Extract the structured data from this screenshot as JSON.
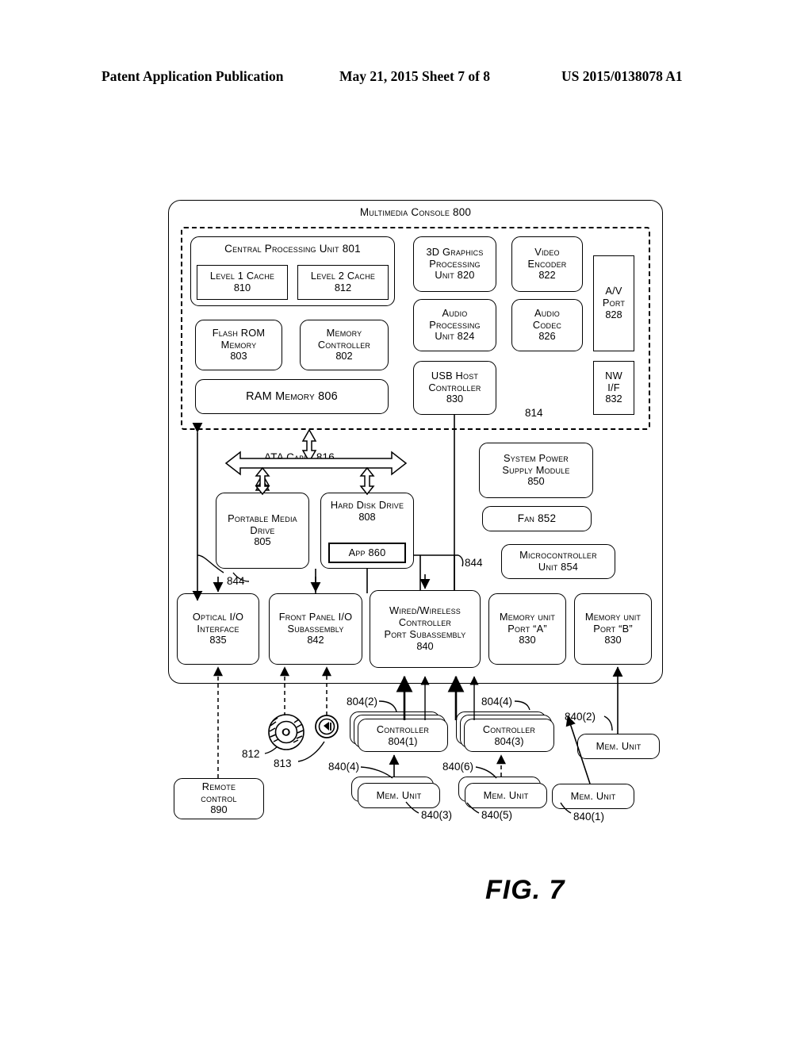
{
  "header": {
    "publication": "Patent Application Publication",
    "date_sheet": "May 21, 2015  Sheet 7 of 8",
    "patent_number": "US 2015/0138078 A1"
  },
  "figure": {
    "label": "FIG. 7"
  },
  "diagram": {
    "console_title": "Multimedia Console 800",
    "cpu": {
      "title": "Central Processing Unit 801",
      "cache1": {
        "line1": "Level 1 Cache",
        "line2": "810"
      },
      "cache2": {
        "line1": "Level 2 Cache",
        "line2": "812"
      }
    },
    "flash_rom": {
      "line1": "Flash ROM",
      "line2": "Memory",
      "line3": "803"
    },
    "memory_controller": {
      "line1": "Memory",
      "line2": "Controller",
      "line3": "802"
    },
    "ram": {
      "line1": "RAM Memory 806"
    },
    "gpu": {
      "line1": "3D Graphics",
      "line2": "Processing",
      "line3": "Unit 820"
    },
    "video_encoder": {
      "line1": "Video",
      "line2": "Encoder",
      "line3": "822"
    },
    "audio_processing": {
      "line1": "Audio",
      "line2": "Processing",
      "line3": "Unit 824"
    },
    "audio_codec": {
      "line1": "Audio",
      "line2": "Codec",
      "line3": "826"
    },
    "usb_host": {
      "line1": "USB Host",
      "line2": "Controller",
      "line3": "830"
    },
    "av_port": {
      "line1": "A/V",
      "line2": "Port",
      "line3": "828"
    },
    "nw_if": {
      "line1": "NW",
      "line2": "I/F",
      "line3": "832"
    },
    "bus_label_814": "814",
    "ata_cable": "ATA Cable 816",
    "portable_media_drive": {
      "line1": "Portable Media",
      "line2": "Drive",
      "line3": "805"
    },
    "hard_disk_drive": {
      "line1": "Hard Disk Drive",
      "line2": "808"
    },
    "app": {
      "line1": "App 860"
    },
    "power_supply": {
      "line1": "System Power",
      "line2": "Supply Module",
      "line3": "850"
    },
    "fan": {
      "line1": "Fan 852"
    },
    "microcontroller": {
      "line1": "Microcontroller",
      "line2": "Unit 854"
    },
    "optical_io": {
      "line1": "Optical I/O",
      "line2": "Interface",
      "line3": "835"
    },
    "front_panel_io": {
      "line1": "Front Panel I/O",
      "line2": "Subassembly",
      "line3": "842"
    },
    "wired_wireless": {
      "line1": "Wired/Wireless",
      "line2": "Controller",
      "line3": "Port Subassembly",
      "line4": "840"
    },
    "memory_unit_port_a": {
      "line1": "Memory unit",
      "line2": "Port “A”",
      "line3": "830"
    },
    "memory_unit_port_b": {
      "line1": "Memory unit",
      "line2": "Port “B”",
      "line3": "830"
    },
    "callout_844_left": "844",
    "callout_844_right": "844",
    "callout_812": "812",
    "callout_813": "813",
    "remote_control": {
      "line1": "Remote",
      "line2": "control",
      "line3": "890"
    },
    "controller_1": {
      "line1": "Controller",
      "line2": "804(1)"
    },
    "controller_3": {
      "line1": "Controller",
      "line2": "804(3)"
    },
    "callout_804_2": "804(2)",
    "callout_804_4": "804(4)",
    "mem_unit_label": "Mem. Unit",
    "callout_840_1": "840(1)",
    "callout_840_2": "840(2)",
    "callout_840_3": "840(3)",
    "callout_840_4": "840(4)",
    "callout_840_5": "840(5)",
    "callout_840_6": "840(6)"
  },
  "colors": {
    "ink": "#000000",
    "paper": "#ffffff"
  }
}
